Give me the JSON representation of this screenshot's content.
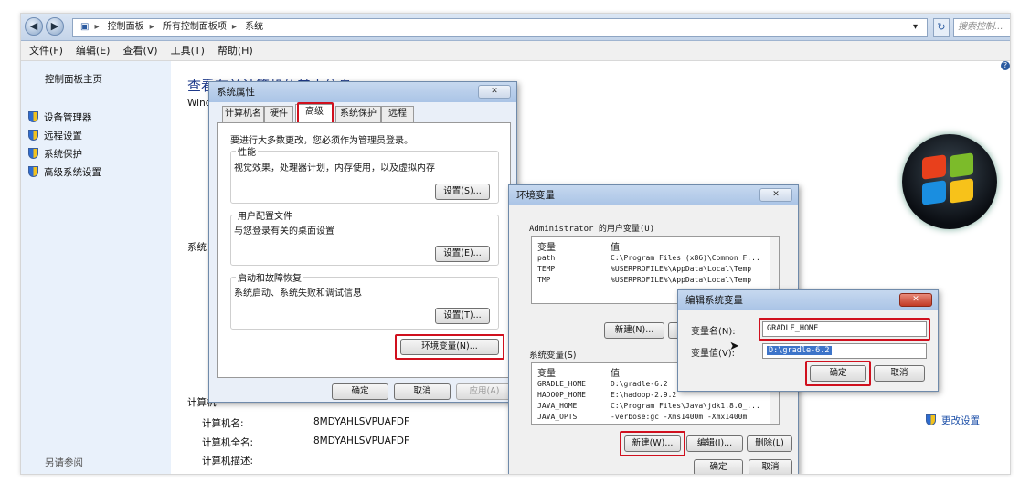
{
  "breadcrumb": {
    "items": [
      "控制面板",
      "所有控制面板项",
      "系统"
    ]
  },
  "search": {
    "placeholder": "搜索控制..."
  },
  "menu": [
    "文件(F)",
    "编辑(E)",
    "查看(V)",
    "工具(T)",
    "帮助(H)"
  ],
  "sidebar": {
    "home": "控制面板主页",
    "items": [
      "设备管理器",
      "远程设置",
      "系统保护",
      "高级系统设置"
    ],
    "see_also": "另请参阅"
  },
  "main": {
    "title": "查看有关计算机的基本信息",
    "windows_section": "Wind",
    "system_section": "系统",
    "computer_section": "计算机",
    "rows": [
      {
        "label": "计算机名:",
        "value": "8MDYAHLSVPUAFDF"
      },
      {
        "label": "计算机全名:",
        "value": "8MDYAHLSVPUAFDF"
      },
      {
        "label": "计算机描述:",
        "value": ""
      }
    ],
    "change_settings": "更改设置"
  },
  "sysprop": {
    "title": "系统属性",
    "tabs": [
      "计算机名",
      "硬件",
      "高级",
      "系统保护",
      "远程"
    ],
    "active_tab": "高级",
    "admin_note": "要进行大多数更改，您必须作为管理员登录。",
    "perf": {
      "label": "性能",
      "desc": "视觉效果，处理器计划，内存使用，以及虚拟内存",
      "button": "设置(S)..."
    },
    "profile": {
      "label": "用户配置文件",
      "desc": "与您登录有关的桌面设置",
      "button": "设置(E)..."
    },
    "startup": {
      "label": "启动和故障恢复",
      "desc": "系统启动、系统失败和调试信息",
      "button": "设置(T)..."
    },
    "env_button": "环境变量(N)...",
    "ok": "确定",
    "cancel": "取消",
    "apply": "应用(A)"
  },
  "envvars": {
    "title": "环境变量",
    "user_group": "Administrator 的用户变量(U)",
    "col_var": "变量",
    "col_val": "值",
    "user_vars": [
      {
        "name": "path",
        "value": "C:\\Program Files (x86)\\Common F..."
      },
      {
        "name": "TEMP",
        "value": "%USERPROFILE%\\AppData\\Local\\Temp"
      },
      {
        "name": "TMP",
        "value": "%USERPROFILE%\\AppData\\Local\\Temp"
      }
    ],
    "user_buttons": [
      "新建(N)...",
      "编"
    ],
    "sys_group": "系统变量(S)",
    "sys_vars": [
      {
        "name": "GRADLE_HOME",
        "value": "D:\\gradle-6.2"
      },
      {
        "name": "HADOOP_HOME",
        "value": "E:\\hadoop-2.9.2"
      },
      {
        "name": "JAVA_HOME",
        "value": "C:\\Program Files\\Java\\jdk1.8.0_..."
      },
      {
        "name": "JAVA_OPTS",
        "value": "-verbose:gc -Xms1400m -Xmx1400m"
      }
    ],
    "sys_buttons": [
      "新建(W)...",
      "编辑(I)...",
      "删除(L)"
    ],
    "ok": "确定",
    "cancel": "取消"
  },
  "editvar": {
    "title": "编辑系统变量",
    "name_label": "变量名(N):",
    "name_value": "GRADLE_HOME",
    "value_label": "变量值(V):",
    "value_value": "D:\\gradle-6.2",
    "ok": "确定",
    "cancel": "取消"
  },
  "colors": {
    "highlight": "#d0101e",
    "title_blue": "#1e3a8a",
    "sidebar_bg": "#e9f1fb"
  }
}
